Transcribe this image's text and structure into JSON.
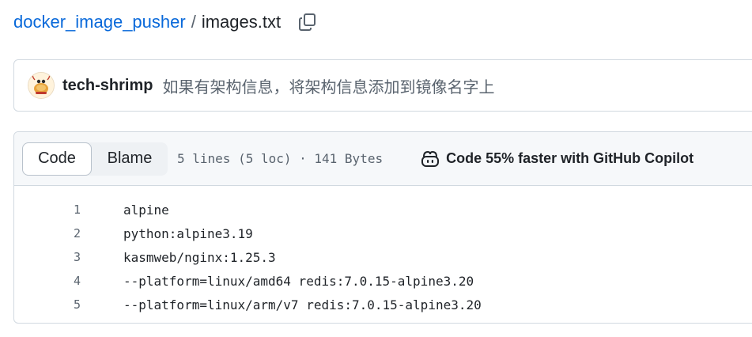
{
  "breadcrumb": {
    "repo": "docker_image_pusher",
    "separator": "/",
    "file": "images.txt"
  },
  "commit": {
    "author": "tech-shrimp",
    "message": "如果有架构信息，将架构信息添加到镜像名字上"
  },
  "file_header": {
    "tabs": [
      {
        "label": "Code",
        "selected": true
      },
      {
        "label": "Blame",
        "selected": false
      }
    ],
    "meta": "5 lines (5 loc) · 141 Bytes",
    "copilot_text": "Code 55% faster with GitHub Copilot"
  },
  "code": {
    "lines": [
      {
        "number": "1",
        "text": "alpine"
      },
      {
        "number": "2",
        "text": "python:alpine3.19"
      },
      {
        "number": "3",
        "text": "kasmweb/nginx:1.25.3"
      },
      {
        "number": "4",
        "text": "--platform=linux/amd64 redis:7.0.15-alpine3.20"
      },
      {
        "number": "5",
        "text": "--platform=linux/arm/v7 redis:7.0.15-alpine3.20"
      }
    ]
  },
  "icons": {
    "copy": "copy-icon",
    "avatar": "avatar-image",
    "copilot": "copilot-icon"
  },
  "colors": {
    "link": "#0969da",
    "text": "#1f2328",
    "muted": "#59636e",
    "border": "#d1d9e0",
    "header_bg": "#f6f8fa"
  }
}
